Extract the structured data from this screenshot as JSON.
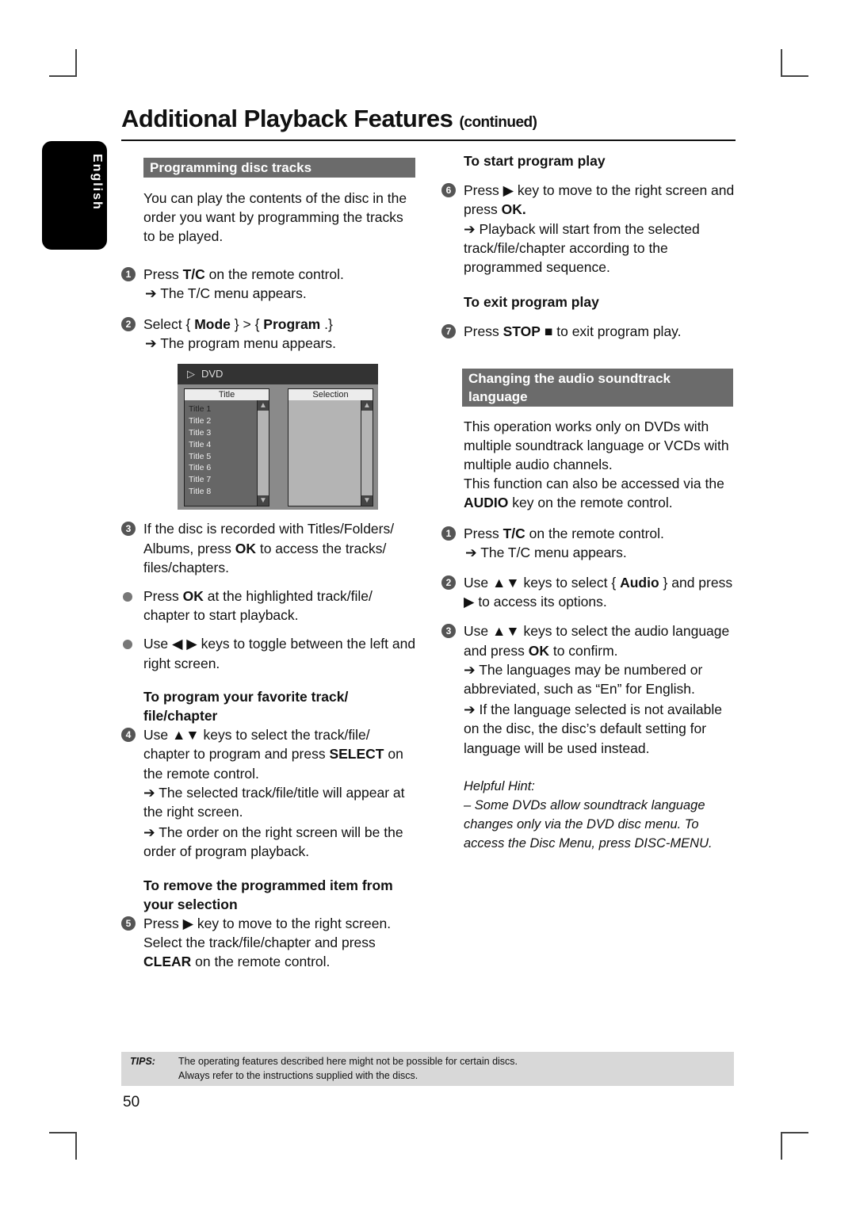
{
  "page": {
    "title": "Additional Playback Features",
    "title_suffix": "(continued)",
    "language_tab": "English",
    "page_number": "50"
  },
  "left": {
    "section_title": "Programming disc tracks",
    "intro": "You can play the contents of the disc in the order you want by programming the tracks to be played.",
    "step1": {
      "num": "1",
      "pre": "Press ",
      "key": "T/C",
      "post": " on the remote control.",
      "result": "➔ The T/C menu appears."
    },
    "step2": {
      "num": "2",
      "pre": "Select { ",
      "key1": "Mode",
      "mid": " } > { ",
      "key2": "Program",
      "post": " .}",
      "result": "➔ The program menu appears."
    },
    "osd": {
      "header": "DVD",
      "play_icon": "▷",
      "left_pane_title": "Title",
      "right_pane_title": "Selection",
      "items": [
        "Title 1",
        "Title 2",
        "Title 3",
        "Title 4",
        "Title 5",
        "Title 6",
        "Title 7",
        "Title 8"
      ],
      "scroll_up": "▲",
      "scroll_down": "▼"
    },
    "step3": {
      "num": "3",
      "pre": "If the disc is recorded with Titles/Folders/ Albums, press ",
      "key": "OK",
      "post": " to access the tracks/ files/chapters."
    },
    "bullet1": {
      "pre": "Press ",
      "key": "OK",
      "post": " at the highlighted track/file/ chapter to start playback."
    },
    "bullet2": {
      "text": "Use ◀ ▶ keys to toggle between the left and right screen."
    },
    "sub_program": "To program your favorite track/ file/chapter",
    "step4": {
      "num": "4",
      "pre": "Use ▲▼ keys to select the track/file/ chapter to program and press ",
      "key": "SELECT",
      "post": " on the remote control.",
      "result1": "➔ The selected track/file/title will appear at the right screen.",
      "result2": "➔ The order on the right screen will be the order of program playback."
    },
    "sub_remove": "To remove the programmed item from your selection",
    "step5": {
      "num": "5",
      "pre": "Press ▶ key to move to the right screen. Select the track/file/chapter and press ",
      "key": "CLEAR",
      "post": " on the remote control."
    }
  },
  "right": {
    "sub_start": "To start program play",
    "step6": {
      "num": "6",
      "pre": "Press ▶ key to move to the right screen and press ",
      "key": "OK.",
      "result": "➔ Playback will start from the selected track/file/chapter according to the programmed sequence."
    },
    "sub_exit": "To exit program play",
    "step7": {
      "num": "7",
      "pre": "Press ",
      "key": "STOP",
      "post": " ■ to exit program play."
    },
    "section_title": "Changing the audio soundtrack language",
    "intro1": "This operation works only on DVDs with multiple soundtrack language or VCDs with multiple audio channels.",
    "intro2_pre": "This function can also be accessed via the ",
    "intro2_key": "AUDIO",
    "intro2_post": " key on the remote control.",
    "step1": {
      "num": "1",
      "pre": "Press ",
      "key": "T/C",
      "post": " on the remote control.",
      "result": "➔ The T/C menu appears."
    },
    "step2": {
      "num": "2",
      "pre": "Use ▲▼ keys to select { ",
      "key": "Audio",
      "post": " } and press ▶ to access its options."
    },
    "step3": {
      "num": "3",
      "pre": "Use ▲▼ keys to select the audio language and press ",
      "key": "OK",
      "post": " to confirm.",
      "result1": "➔ The languages may be numbered or abbreviated, such as “En” for English.",
      "result2": "➔ If the language selected is not available on the disc, the disc’s default setting for language will be used instead."
    },
    "hint_title": "Helpful Hint:",
    "hint_text": "– Some DVDs allow soundtrack language changes only via the DVD disc menu. To access the Disc Menu, press DISC-MENU."
  },
  "tips": {
    "label": "TIPS:",
    "line1": "The operating features described here might not be possible for certain discs.",
    "line2": "Always refer to the instructions supplied with the discs."
  }
}
